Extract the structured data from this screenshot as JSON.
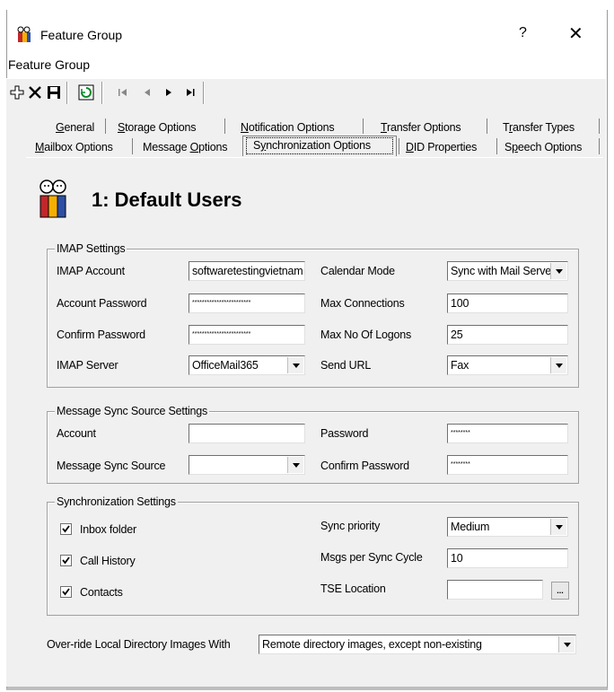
{
  "window": {
    "title": "Feature Group",
    "subtitle": "Feature Group",
    "help_label": "?",
    "close_label": "✕"
  },
  "toolbar": {
    "icons": [
      "add-icon",
      "delete-icon",
      "save-icon",
      "refresh-icon",
      "first-record-icon",
      "previous-record-icon",
      "next-record-icon",
      "last-record-icon"
    ]
  },
  "tabs": {
    "row1": [
      {
        "pre": "",
        "u": "G",
        "post": "eneral"
      },
      {
        "pre": "",
        "u": "S",
        "post": "torage Options"
      },
      {
        "pre": "",
        "u": "N",
        "post": "otification Options"
      },
      {
        "pre": "",
        "u": "T",
        "post": "ransfer Options"
      },
      {
        "pre": "T",
        "u": "r",
        "post": "ansfer Types"
      }
    ],
    "row2": [
      {
        "pre": "",
        "u": "M",
        "post": "ailbox Options"
      },
      {
        "pre": "Message ",
        "u": "O",
        "post": "ptions"
      },
      {
        "pre": "S",
        "u": "y",
        "post": "nchronization Options"
      },
      {
        "pre": "",
        "u": "D",
        "post": "ID Properties"
      },
      {
        "pre": "S",
        "u": "p",
        "post": "eech Options"
      }
    ],
    "active": "Synchronization Options"
  },
  "header": {
    "title": "1: Default Users"
  },
  "imap": {
    "legend": "IMAP Settings",
    "account_label": "IMAP Account",
    "account_value": "softwaretestingvietnam",
    "password_label": "Account Password",
    "password_value": "************************",
    "confirm_label": "Confirm Password",
    "confirm_value": "************************",
    "server_label": "IMAP Server",
    "server_value": "OfficeMail365",
    "calendar_label": "Calendar Mode",
    "calendar_value": "Sync with Mail Server",
    "maxconn_label": "Max Connections",
    "maxconn_value": "100",
    "maxlogons_label": "Max No Of Logons",
    "maxlogons_value": "25",
    "sendurl_label": "Send URL",
    "sendurl_value": "Fax"
  },
  "msgsync": {
    "legend": "Message Sync Source Settings",
    "account_label": "Account",
    "account_value": "",
    "source_label": "Message Sync Source",
    "source_value": "",
    "password_label": "Password",
    "password_value": "********",
    "confirm_label": "Confirm Password",
    "confirm_value": "********"
  },
  "sync": {
    "legend": "Synchronization Settings",
    "inbox_label": "Inbox folder",
    "inbox_checked": true,
    "callhistory_label": "Call History",
    "callhistory_checked": true,
    "contacts_label": "Contacts",
    "contacts_checked": true,
    "priority_label": "Sync priority",
    "priority_value": "Medium",
    "msgs_label": "Msgs per Sync Cycle",
    "msgs_value": "10",
    "tse_label": "TSE Location",
    "tse_value": "",
    "tse_button": "..."
  },
  "override": {
    "label": "Over-ride Local Directory Images With",
    "value": "Remote directory images, except non-existing"
  }
}
